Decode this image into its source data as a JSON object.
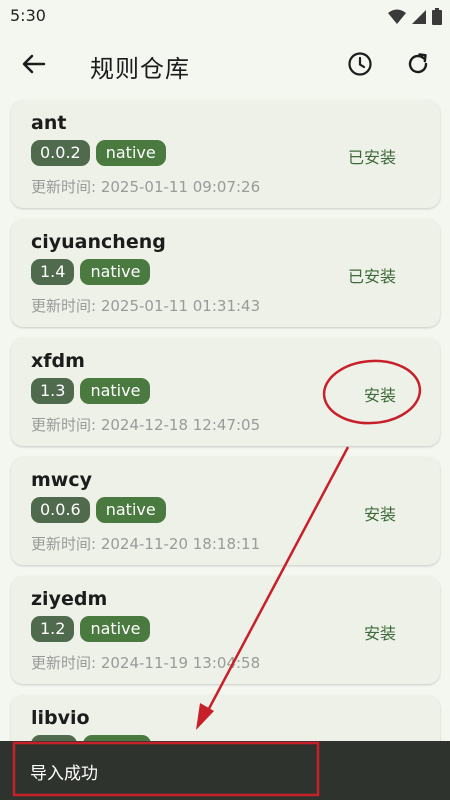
{
  "status_bar": {
    "time": "5:30",
    "icons": [
      "wifi-icon",
      "signal-icon",
      "battery-icon"
    ]
  },
  "app_bar": {
    "title": "规则仓库",
    "back_icon": "arrow-left-icon",
    "actions": [
      "history-icon",
      "refresh-icon"
    ]
  },
  "rules": [
    {
      "name": "ant",
      "version": "0.0.2",
      "type": "native",
      "updated": "更新时间: 2025-01-11 09:07:26",
      "action": "已安装"
    },
    {
      "name": "ciyuancheng",
      "version": "1.4",
      "type": "native",
      "updated": "更新时间: 2025-01-11 01:31:43",
      "action": "已安装"
    },
    {
      "name": "xfdm",
      "version": "1.3",
      "type": "native",
      "updated": "更新时间: 2024-12-18 12:47:05",
      "action": "安装"
    },
    {
      "name": "mwcy",
      "version": "0.0.6",
      "type": "native",
      "updated": "更新时间: 2024-11-20 18:18:11",
      "action": "安装"
    },
    {
      "name": "ziyedm",
      "version": "1.2",
      "type": "native",
      "updated": "更新时间: 2024-11-19 13:04:58",
      "action": "安装"
    },
    {
      "name": "libvio",
      "version": "",
      "type": "",
      "updated": "",
      "action": ""
    }
  ],
  "snackbar": {
    "message": "导入成功"
  },
  "colors": {
    "background": "#f4f6f0",
    "card": "#eef1e8",
    "accent": "#3e6a3a",
    "tag_version": "#4f6a4c",
    "tag_type": "#4a7a3f",
    "annotation": "#c8202a",
    "snackbar": "#2f332e"
  }
}
